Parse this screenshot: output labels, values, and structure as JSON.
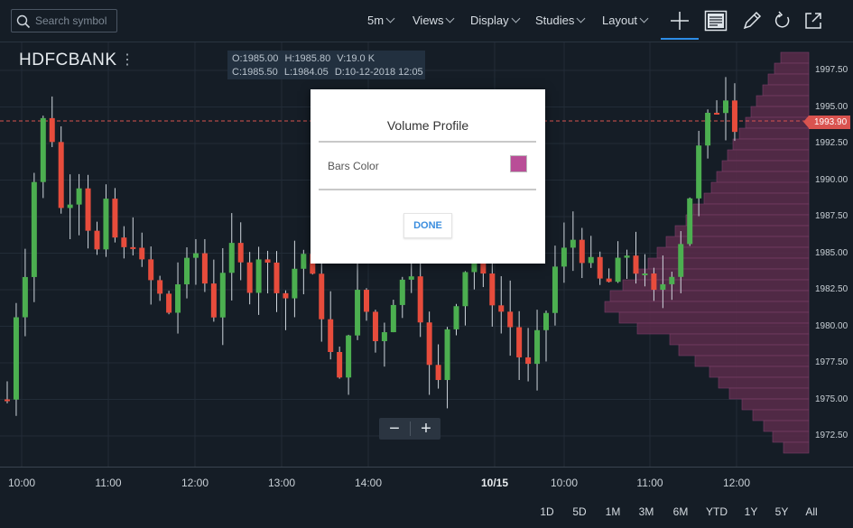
{
  "toolbar": {
    "search_placeholder": "Search symbol",
    "interval": "5m",
    "views": "Views",
    "display": "Display",
    "studies": "Studies",
    "layout": "Layout",
    "tools": [
      "crosshair-icon",
      "notes-icon",
      "pencil-icon",
      "refresh-icon",
      "popout-icon"
    ]
  },
  "symbol": {
    "name": "HDFCBANK",
    "menu": "⋮"
  },
  "ohlc": {
    "o": "O:1985.00",
    "h": "H:1985.80",
    "v": "V:19.0 K",
    "c": "C:1985.50",
    "l": "L:1984.05",
    "d": "D:10-12-2018 12:05"
  },
  "price_axis": [
    "1997.50",
    "1995.00",
    "1992.50",
    "1990.00",
    "1987.50",
    "1985.00",
    "1982.50",
    "1980.00",
    "1977.50",
    "1975.00",
    "1972.50"
  ],
  "current_price": "1993.90",
  "time_axis": [
    {
      "label": "10:00",
      "bold": false
    },
    {
      "label": "11:00",
      "bold": false
    },
    {
      "label": "12:00",
      "bold": false
    },
    {
      "label": "13:00",
      "bold": false
    },
    {
      "label": "14:00",
      "bold": false
    },
    {
      "label": "10/15",
      "bold": true
    },
    {
      "label": "10:00",
      "bold": false
    },
    {
      "label": "11:00",
      "bold": false
    },
    {
      "label": "12:00",
      "bold": false
    }
  ],
  "ranges": [
    "1D",
    "5D",
    "1M",
    "3M",
    "6M",
    "YTD",
    "1Y",
    "5Y",
    "All"
  ],
  "zoom": {
    "minus": "−",
    "plus": "+"
  },
  "colors": {
    "up": "#4caf50",
    "down": "#e74c3c",
    "profile": "#5a2b4b",
    "swatch": "#b94e97",
    "accent": "#2d8ce6"
  },
  "dialog": {
    "title": "Volume Profile",
    "bars_color_label": "Bars Color",
    "done": "DONE"
  }
}
